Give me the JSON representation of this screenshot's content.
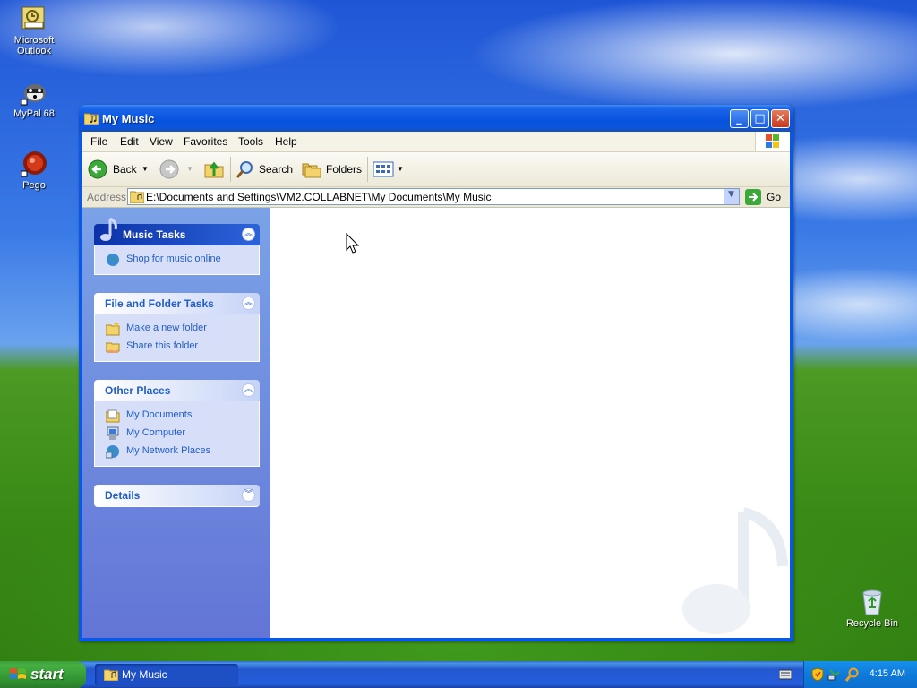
{
  "desktop": {
    "icons": [
      {
        "label": "Microsoft Outlook",
        "icon": "outlook-icon"
      },
      {
        "label": "MyPal 68",
        "icon": "raccoon-icon"
      },
      {
        "label": "Pego",
        "icon": "pego-icon"
      },
      {
        "label": "Recycle Bin",
        "icon": "recycle-bin-icon"
      }
    ]
  },
  "window": {
    "title": "My Music",
    "menu": [
      "File",
      "Edit",
      "View",
      "Favorites",
      "Tools",
      "Help"
    ],
    "toolbar": {
      "back_label": "Back",
      "search_label": "Search",
      "folders_label": "Folders"
    },
    "address": {
      "label": "Address",
      "value": "E:\\Documents and Settings\\VM2.COLLABNET\\My Documents\\My Music",
      "go_label": "Go"
    },
    "panels": {
      "music_tasks": {
        "title": "Music Tasks",
        "items": [
          "Shop for music online"
        ]
      },
      "file_folder_tasks": {
        "title": "File and Folder Tasks",
        "items": [
          "Make a new folder",
          "Share this folder"
        ]
      },
      "other_places": {
        "title": "Other Places",
        "items": [
          "My Documents",
          "My Computer",
          "My Network Places"
        ]
      },
      "details": {
        "title": "Details"
      }
    }
  },
  "taskbar": {
    "start_label": "start",
    "tasks": [
      "My Music"
    ],
    "clock": "4:15 AM"
  },
  "colors": {
    "titlebar": "#0753df",
    "taskpane_link": "#215dc6",
    "taskbar": "#245edb",
    "start_green": "#45b042"
  }
}
